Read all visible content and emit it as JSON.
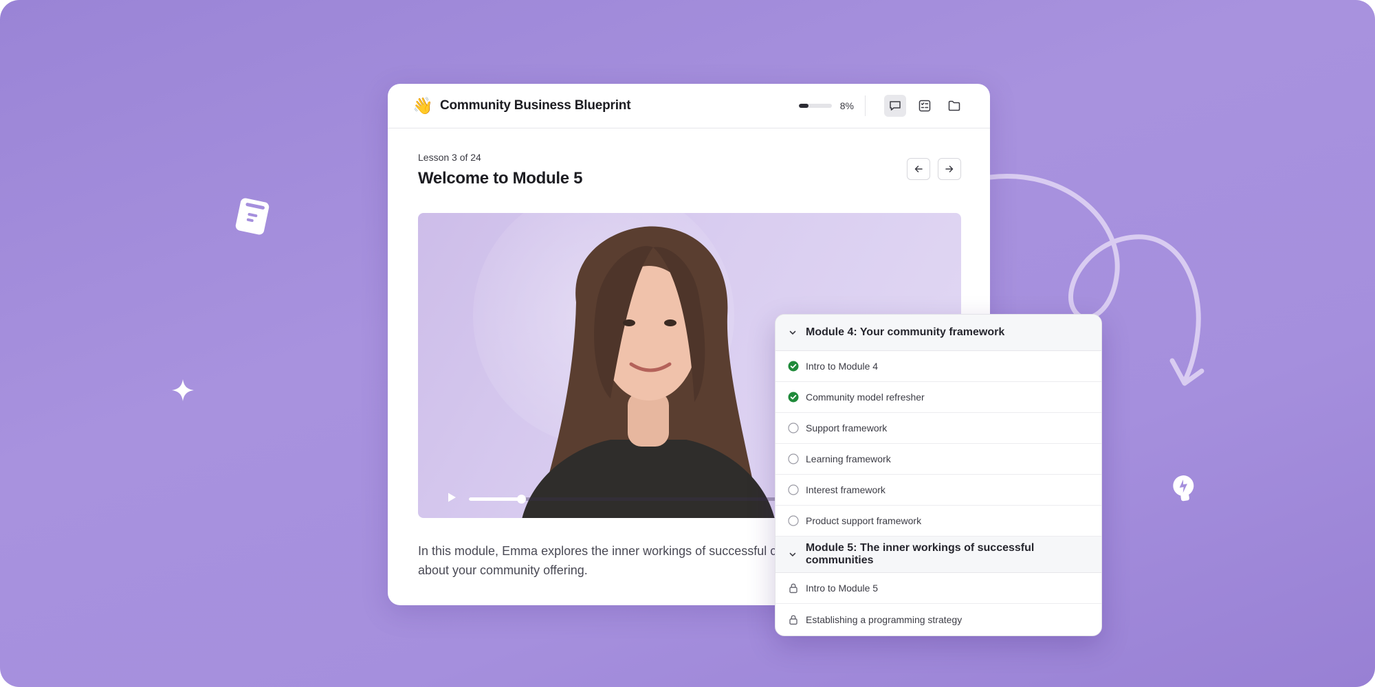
{
  "course": {
    "emoji": "👋",
    "title": "Community Business Blueprint",
    "progress_percent": 8,
    "progress_label": "8%"
  },
  "lesson": {
    "meta": "Lesson 3 of 24",
    "title": "Welcome to Module 5",
    "description": "In this module, Emma explores the inner workings of successful c important decisions about your community offering."
  },
  "video": {
    "progress_fraction": 0.11
  },
  "curriculum": {
    "modules": [
      {
        "title": "Module 4: Your community framework",
        "lessons": [
          {
            "label": "Intro to Module 4",
            "status": "complete"
          },
          {
            "label": "Community model refresher",
            "status": "complete"
          },
          {
            "label": "Support framework",
            "status": "incomplete"
          },
          {
            "label": "Learning framework",
            "status": "incomplete"
          },
          {
            "label": "Interest framework",
            "status": "incomplete"
          },
          {
            "label": "Product support framework",
            "status": "incomplete"
          }
        ]
      },
      {
        "title": "Module 5: The inner workings of successful communities",
        "lessons": [
          {
            "label": "Intro to Module 5",
            "status": "locked"
          },
          {
            "label": "Establishing a programming strategy",
            "status": "locked"
          }
        ]
      }
    ]
  },
  "colors": {
    "background": "#a58fdd",
    "complete": "#1f8a3a",
    "accent_dark": "#2b2b33"
  },
  "icons": {
    "header_buttons": [
      "chat-icon",
      "checklist-icon",
      "folder-icon"
    ],
    "nav": [
      "arrow-left-icon",
      "arrow-right-icon"
    ]
  }
}
